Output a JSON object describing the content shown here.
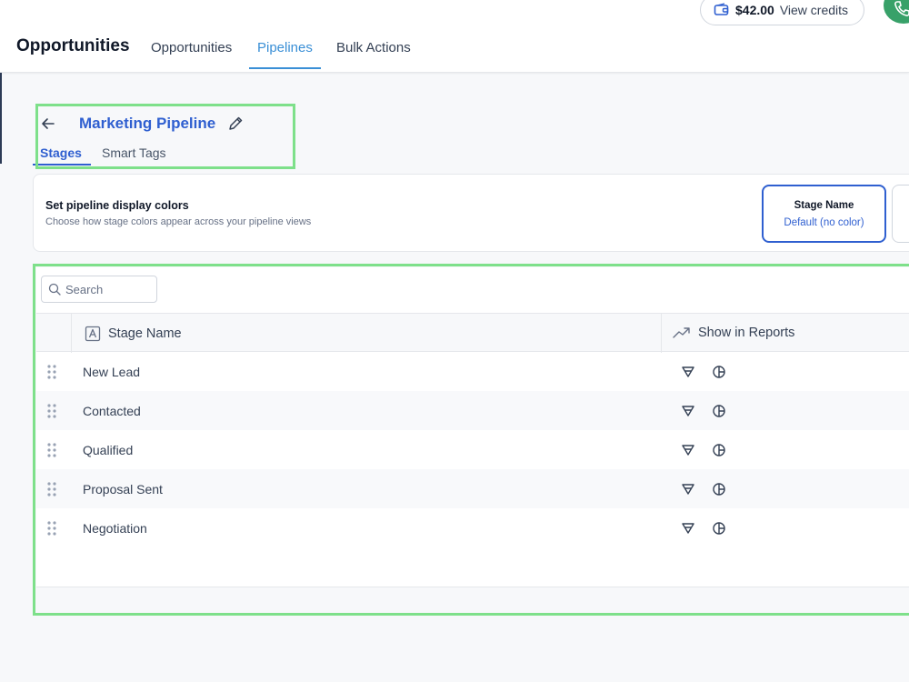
{
  "header": {
    "app_title": "Opportunities",
    "tabs": [
      {
        "label": "Opportunities",
        "active": false
      },
      {
        "label": "Pipelines",
        "active": true
      },
      {
        "label": "Bulk Actions",
        "active": false
      }
    ],
    "credits_amount": "$42.00",
    "credits_label": "View credits",
    "accent_color": "#3a8fd6",
    "call_button_color": "#38a169"
  },
  "pipeline": {
    "title": "Marketing Pipeline",
    "tabs": [
      {
        "label": "Stages",
        "active": true
      },
      {
        "label": "Smart Tags",
        "active": false
      }
    ]
  },
  "display_colors": {
    "title": "Set pipeline display colors",
    "description": "Choose how stage colors appear across your pipeline views",
    "selected_option": {
      "title": "Stage Name",
      "subtitle": "Default (no color)"
    }
  },
  "table": {
    "search_placeholder": "Search",
    "columns": [
      "Stage Name",
      "Show in Reports"
    ],
    "rows": [
      {
        "stage": "New Lead"
      },
      {
        "stage": "Contacted"
      },
      {
        "stage": "Qualified"
      },
      {
        "stage": "Proposal Sent"
      },
      {
        "stage": "Negotiation"
      }
    ]
  },
  "highlight_color": "#7ee08a"
}
